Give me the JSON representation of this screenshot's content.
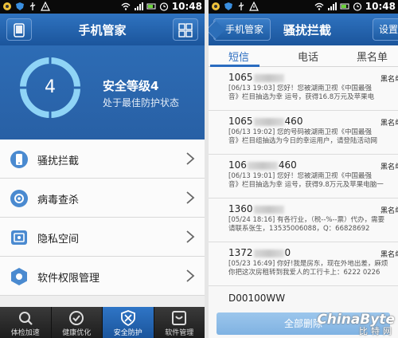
{
  "status_bar": {
    "time": "10:48"
  },
  "left": {
    "title": "手机管家",
    "security": {
      "level_number": "4",
      "level_title": "安全等级4",
      "level_subtitle": "处于最佳防护状态"
    },
    "menu": [
      {
        "label": "骚扰拦截",
        "icon": "phone-block-icon"
      },
      {
        "label": "病毒查杀",
        "icon": "shield-scan-icon"
      },
      {
        "label": "隐私空间",
        "icon": "privacy-safe-icon"
      },
      {
        "label": "软件权限管理",
        "icon": "permission-hex-icon"
      }
    ],
    "tabs": [
      {
        "label": "体检加速",
        "icon": "checkup-icon",
        "active": false
      },
      {
        "label": "健康优化",
        "icon": "optimize-check-icon",
        "active": false
      },
      {
        "label": "安全防护",
        "icon": "security-shield-icon",
        "active": true
      },
      {
        "label": "软件管理",
        "icon": "software-box-icon",
        "active": false
      }
    ]
  },
  "right": {
    "back_label": "手机管家",
    "title": "骚扰拦截",
    "settings_label": "设置",
    "tabs": [
      {
        "label": "短信",
        "active": true
      },
      {
        "label": "电话",
        "active": false
      },
      {
        "label": "黑名单",
        "active": false
      }
    ],
    "messages": [
      {
        "sender_prefix": "1065",
        "sender_suffix": "",
        "tag": "黑名单",
        "line1": "[06/13 19:03] 您好！您被湖南卫视《中国最强",
        "line2": "音》栏目抽选为幸 运号，获得16.8万元及苹果电"
      },
      {
        "sender_prefix": "1065",
        "sender_suffix": "460",
        "tag": "黑名单",
        "line1": "[06/13 19:02] 您的号码被湖南卫视《中国最强",
        "line2": "音》栏目组抽选为今日的幸运用户，请登陆活动网"
      },
      {
        "sender_prefix": "106",
        "sender_suffix": "460",
        "tag": "黑名单",
        "line1": "[06/13 19:01] 您好！您被湖南卫视《中国最强",
        "line2": "音》栏目抽选为幸 运号，获得9.8万元及苹果电脑一"
      },
      {
        "sender_prefix": "1360",
        "sender_suffix": "",
        "tag": "黑名单",
        "line1": "[05/24 18:16] 有各行业，（税--%--票）代办，需要",
        "line2": "请联系张生，13535006088，Q：66828692"
      },
      {
        "sender_prefix": "1372",
        "sender_suffix": "0",
        "tag": "黑名单",
        "line1": "[05/23 16:49] 你好!我是房东，现在外地出差，麻烦",
        "line2": "你把这次房租转到我爱人的工行卡上：6222 0226"
      }
    ],
    "last_sender": "D00100WW",
    "delete_all_label": "全部删除"
  },
  "watermark": {
    "main": "ChinaByte",
    "sub": "比特网"
  },
  "colors": {
    "primary": "#2a66ad",
    "tab_active": "#2a6cc0",
    "delete_bar": "#8dbce7"
  }
}
